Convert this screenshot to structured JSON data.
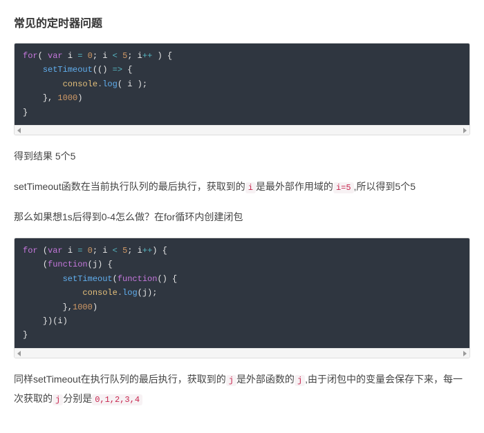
{
  "heading": "常见的定时器问题",
  "code1": {
    "l1a": "for",
    "l1b": "var",
    "l1c": "i",
    "l1d": "=",
    "l1e": "0",
    "l1f": "; i",
    "l1g": "<",
    "l1h": "5",
    "l1i": "; i",
    "l1j": "++",
    "l1k": " ) {",
    "l2a": "setTimeout",
    "l2b": "(()",
    "l2c": "=>",
    "l2d": "{",
    "l3a": "console",
    "l3b": ".",
    "l3c": "log",
    "l3d": "( i );",
    "l4a": "},",
    "l4b": "1000",
    "l4c": ")",
    "l5": "}"
  },
  "para1": "得到结果 5个5",
  "para2a": "setTimeout函数在当前执行队列的最后执行，获取到的",
  "para2code1": "i",
  "para2b": "是最外部作用域的",
  "para2code2": "i=5",
  "para2c": ",所以得到5个5",
  "para3": "那么如果想1s后得到0-4怎么做？在for循环内创建闭包",
  "code2": {
    "l1a": "for",
    "l1b": "(",
    "l1c": "var",
    "l1d": "i",
    "l1e": "=",
    "l1f": "0",
    "l1g": "; i",
    "l1h": "<",
    "l1i": "5",
    "l1j": "; i",
    "l1k": "++",
    "l1l": ") {",
    "l2a": "(",
    "l2b": "function",
    "l2c": "(j)",
    "l2d": "{",
    "l3a": "setTimeout",
    "l3b": "(",
    "l3c": "function",
    "l3d": "()",
    "l3e": "{",
    "l4a": "console",
    "l4b": ".",
    "l4c": "log",
    "l4d": "(j);",
    "l5a": "},",
    "l5b": "1000",
    "l5c": ")",
    "l6": "})(i)",
    "l7": "}"
  },
  "para4a": "同样setTimeout在执行队列的最后执行，获取到的",
  "para4code1": "j",
  "para4b": "是外部函数的",
  "para4code2": "j",
  "para4c": ",由于闭包中的变量会保存下来，每一次获取的",
  "para4code3": "j",
  "para4d": "分别是",
  "para4code4": "0,1,2,3,4"
}
